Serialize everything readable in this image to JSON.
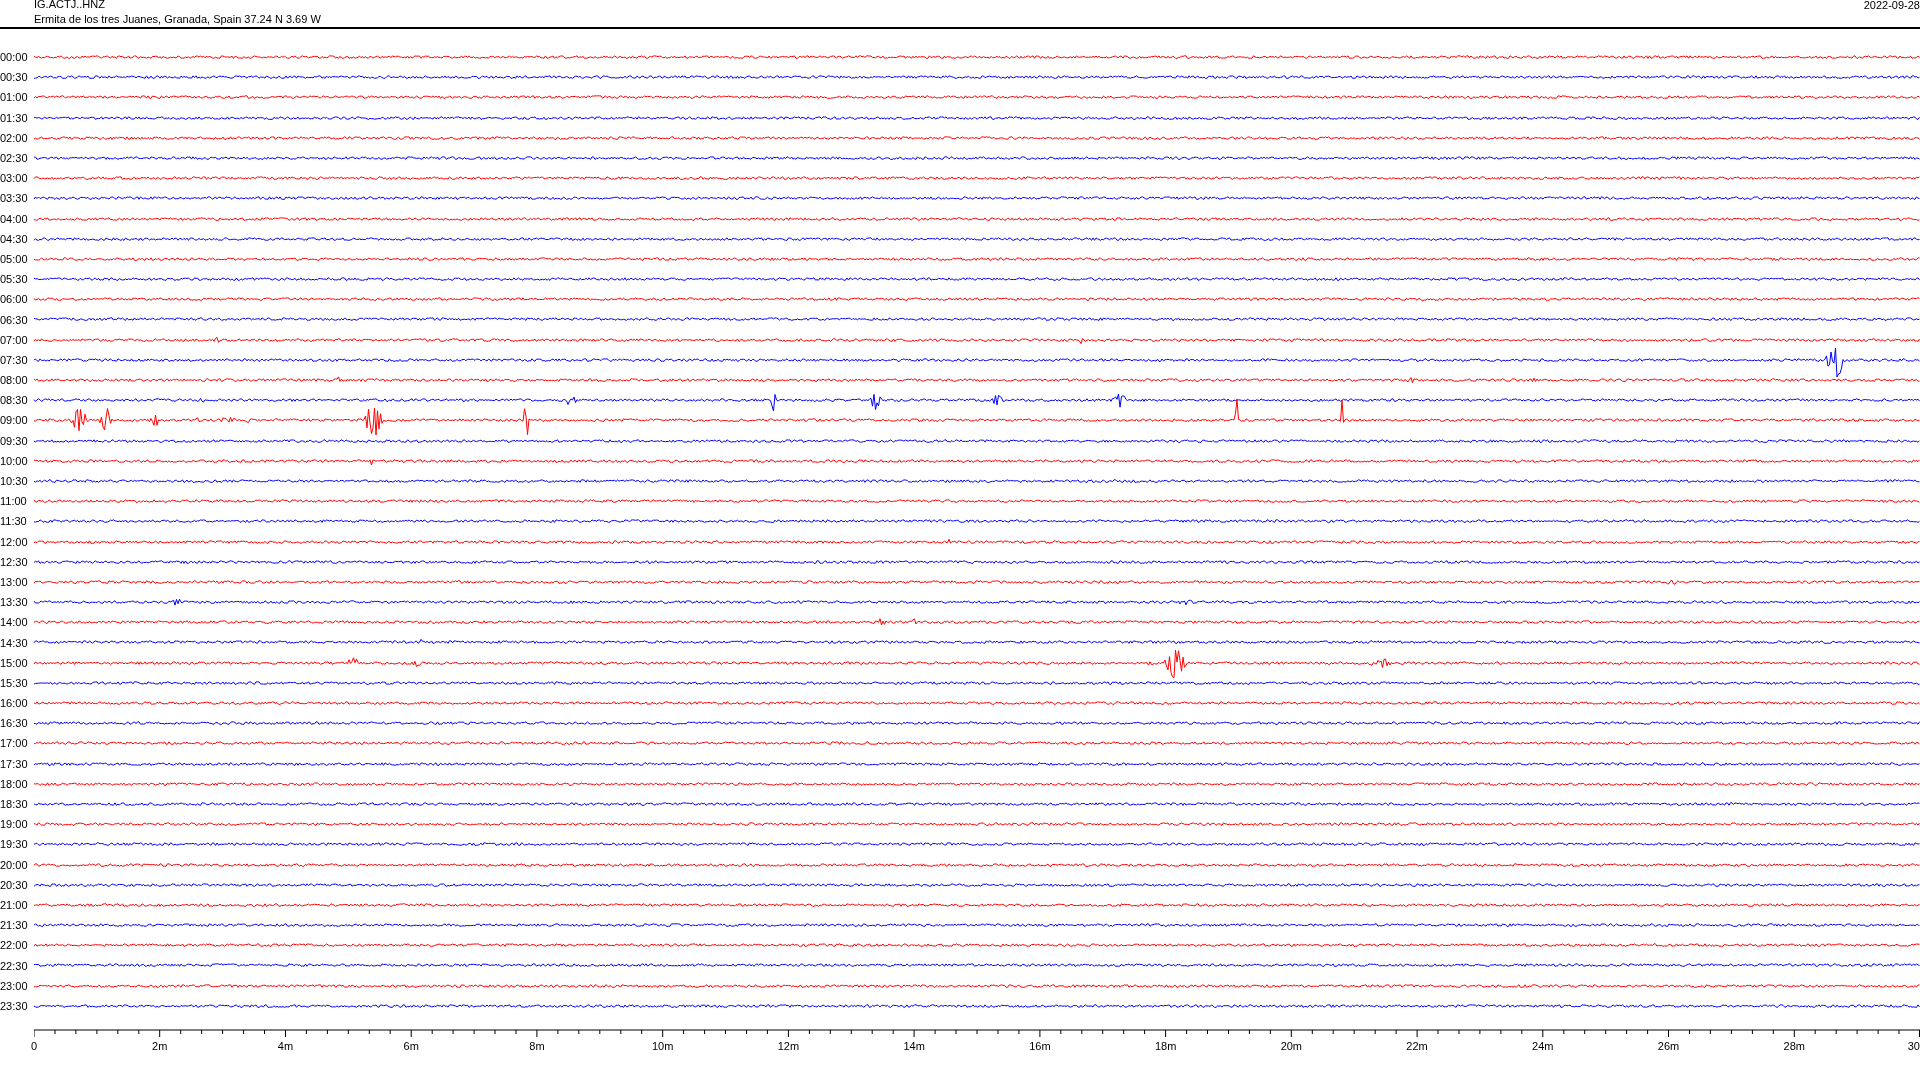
{
  "header": {
    "station": "IG.ACTJ..HNZ",
    "location": "Ermita de los tres Juanes, Granada, Spain  37.24 N 3.69 W",
    "date": "2022-09-28"
  },
  "traces": [
    {
      "label": "00:00",
      "color": "#ff0000"
    },
    {
      "label": "00:30",
      "color": "#0000ff"
    },
    {
      "label": "01:00",
      "color": "#ff0000"
    },
    {
      "label": "01:30",
      "color": "#0000ff"
    },
    {
      "label": "02:00",
      "color": "#ff0000"
    },
    {
      "label": "02:30",
      "color": "#0000ff"
    },
    {
      "label": "03:00",
      "color": "#ff0000"
    },
    {
      "label": "03:30",
      "color": "#0000ff"
    },
    {
      "label": "04:00",
      "color": "#ff0000"
    },
    {
      "label": "04:30",
      "color": "#0000ff"
    },
    {
      "label": "05:00",
      "color": "#ff0000"
    },
    {
      "label": "05:30",
      "color": "#0000ff"
    },
    {
      "label": "06:00",
      "color": "#ff0000"
    },
    {
      "label": "06:30",
      "color": "#0000ff"
    },
    {
      "label": "07:00",
      "color": "#ff0000"
    },
    {
      "label": "07:30",
      "color": "#0000ff"
    },
    {
      "label": "08:00",
      "color": "#ff0000"
    },
    {
      "label": "08:30",
      "color": "#0000ff"
    },
    {
      "label": "09:00",
      "color": "#ff0000"
    },
    {
      "label": "09:30",
      "color": "#0000ff"
    },
    {
      "label": "10:00",
      "color": "#ff0000"
    },
    {
      "label": "10:30",
      "color": "#0000ff"
    },
    {
      "label": "11:00",
      "color": "#ff0000"
    },
    {
      "label": "11:30",
      "color": "#0000ff"
    },
    {
      "label": "12:00",
      "color": "#ff0000"
    },
    {
      "label": "12:30",
      "color": "#0000ff"
    },
    {
      "label": "13:00",
      "color": "#ff0000"
    },
    {
      "label": "13:30",
      "color": "#0000ff"
    },
    {
      "label": "14:00",
      "color": "#ff0000"
    },
    {
      "label": "14:30",
      "color": "#0000ff"
    },
    {
      "label": "15:00",
      "color": "#ff0000"
    },
    {
      "label": "15:30",
      "color": "#0000ff"
    },
    {
      "label": "16:00",
      "color": "#ff0000"
    },
    {
      "label": "16:30",
      "color": "#0000ff"
    },
    {
      "label": "17:00",
      "color": "#ff0000"
    },
    {
      "label": "17:30",
      "color": "#0000ff"
    },
    {
      "label": "18:00",
      "color": "#ff0000"
    },
    {
      "label": "18:30",
      "color": "#0000ff"
    },
    {
      "label": "19:00",
      "color": "#ff0000"
    },
    {
      "label": "19:30",
      "color": "#0000ff"
    },
    {
      "label": "20:00",
      "color": "#ff0000"
    },
    {
      "label": "20:30",
      "color": "#0000ff"
    },
    {
      "label": "21:00",
      "color": "#ff0000"
    },
    {
      "label": "21:30",
      "color": "#0000ff"
    },
    {
      "label": "22:00",
      "color": "#ff0000"
    },
    {
      "label": "22:30",
      "color": "#0000ff"
    },
    {
      "label": "23:00",
      "color": "#ff0000"
    },
    {
      "label": "23:30",
      "color": "#0000ff"
    }
  ],
  "x_axis": {
    "tick_labels": [
      "0",
      "2m",
      "4m",
      "6m",
      "8m",
      "10m",
      "12m",
      "14m",
      "16m",
      "18m",
      "20m",
      "22m",
      "24m",
      "26m",
      "28m",
      "30"
    ]
  }
}
